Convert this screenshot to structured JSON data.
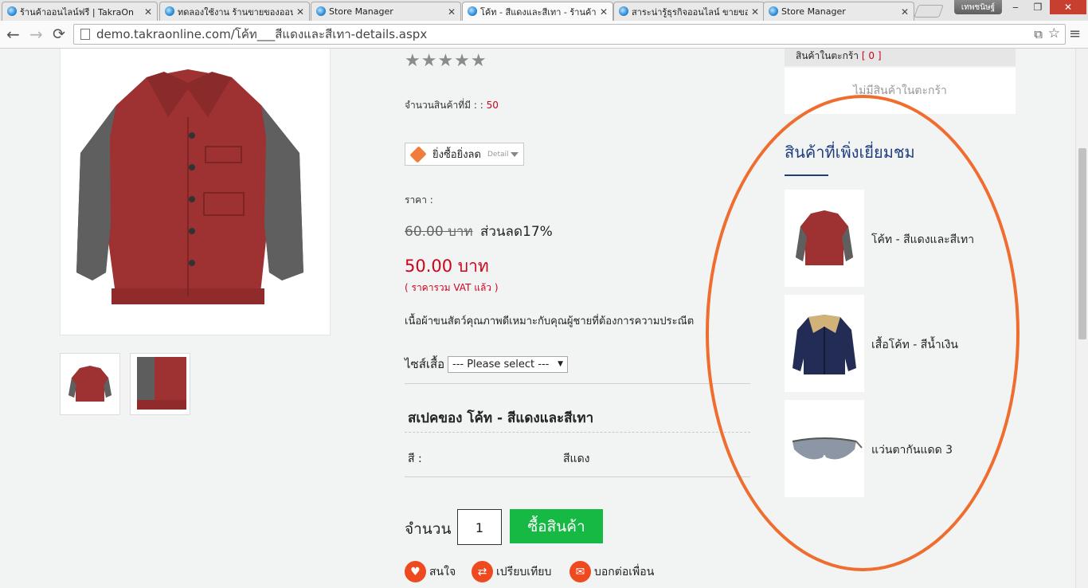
{
  "browser": {
    "tabs": [
      {
        "title": "ร้านค้าออนไลน์ฟรี | TakraOn"
      },
      {
        "title": "ทดลองใช้งาน ร้านขายของออน"
      },
      {
        "title": "Store Manager"
      },
      {
        "title": "โค้ท - สีแดงและสีเทา - ร้านค้า"
      },
      {
        "title": "สาระน่ารู้ธุรกิจออนไลน์ ขายของ"
      },
      {
        "title": "Store Manager"
      }
    ],
    "active_tab_index": 3,
    "profile_name": "เทพชนิษฐ์",
    "url": "demo.takraonline.com/โค้ท___สีแดงและสีเทา-details.aspx"
  },
  "product": {
    "stars": "★★★★★",
    "stock_label": "จำนวนสินค้าที่มี : :",
    "stock_value": "50",
    "promo_label": "ยิ่งซื้อยิ่งลด",
    "promo_detail": "Detail",
    "price_label": "ราคา :",
    "old_price": "60.00 บาท",
    "discount": "ส่วนลด17%",
    "price": "50.00 บาท",
    "vat_note": "( ราคารวม VAT แล้ว )",
    "description": "เนื้อผ้าขนสัตว์คุณภาพดีเหมาะกับคุณผู้ชายที่ต้องการความประณีต",
    "size_label": "ไซส์เสื้อ",
    "size_selected": "--- Please select ---",
    "spec_title": "สเปคของ โค้ท - สีแดงและสีเทา",
    "spec_key": "สี :",
    "spec_value": "สีแดง",
    "qty_label": "จำนวน",
    "qty_value": "1",
    "buy_label": "ซื้อสินค้า",
    "actions": {
      "like": "สนใจ",
      "compare": "เปรียบเทียบ",
      "share": "บอกต่อเพื่อน"
    }
  },
  "sidebar": {
    "cart_title": "สินค้าในตะกร้า",
    "cart_count": "[ 0 ]",
    "cart_empty": "ไม่มีสินค้าในตะกร้า",
    "recent_title": "สินค้าที่เพิ่งเยี่ยมชม",
    "recent_items": [
      {
        "name": "โค้ท - สีแดงและสีเทา"
      },
      {
        "name": "เสื้อโค้ท - สีน้ำเงิน"
      },
      {
        "name": "แว่นตากันแดด 3"
      }
    ]
  },
  "colors": {
    "price_red": "#d0021b",
    "buy_green": "#16b944",
    "heading_blue": "#1f3e80",
    "highlight_orange": "#ef6d2e",
    "action_orange": "#ef4a1f"
  }
}
